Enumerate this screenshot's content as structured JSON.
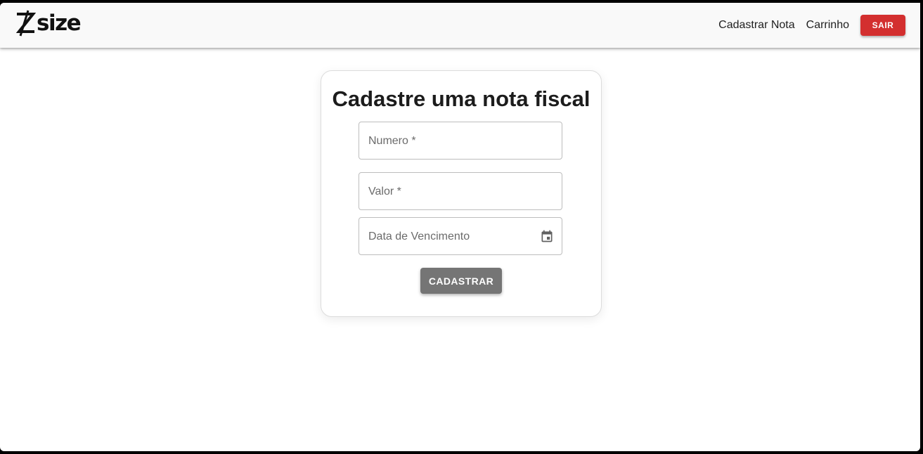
{
  "navbar": {
    "logo_text": "size",
    "links": {
      "register_note": "Cadastrar Nota",
      "cart": "Carrinho"
    },
    "logout_label": "SAIR",
    "logout_color": "#d32f2f"
  },
  "form": {
    "title": "Cadastre uma nota fiscal",
    "fields": {
      "numero": "Numero *",
      "valor": "Valor *",
      "vencimento": "Data de Vencimento"
    },
    "calendar_icon": "calendar-icon",
    "submit_label": "CADASTRAR",
    "submit_color": "#757575"
  }
}
